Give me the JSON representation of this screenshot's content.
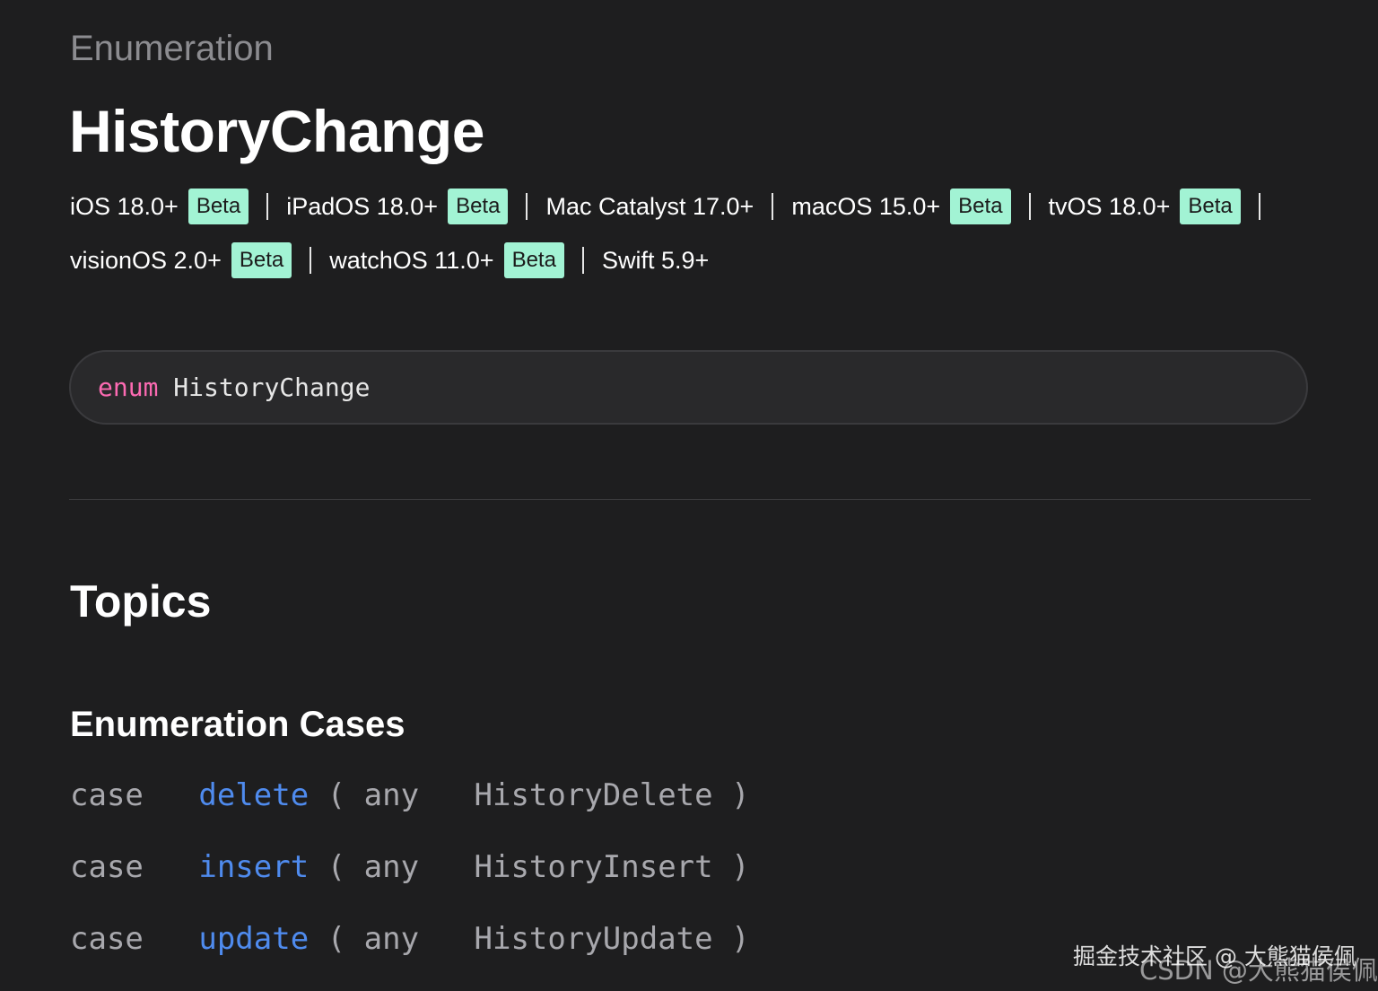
{
  "header": {
    "eyebrow": "Enumeration",
    "title": "HistoryChange"
  },
  "availability": {
    "row1": [
      {
        "label": "iOS 18.0+",
        "badge": "Beta"
      },
      {
        "label": "iPadOS 18.0+",
        "badge": "Beta"
      },
      {
        "label": "Mac Catalyst 17.0+"
      },
      {
        "label": "macOS 15.0+",
        "badge": "Beta"
      },
      {
        "label": "tvOS 18.0+",
        "badge": "Beta"
      }
    ],
    "row2": [
      {
        "label": "visionOS 2.0+",
        "badge": "Beta"
      },
      {
        "label": "watchOS 11.0+",
        "badge": "Beta"
      },
      {
        "label": "Swift 5.9+"
      }
    ]
  },
  "declaration": {
    "keyword": "enum",
    "name": "HistoryChange"
  },
  "topics": {
    "heading": "Topics",
    "section_title": "Enumeration Cases",
    "cases": [
      {
        "keyword": "case",
        "name": "delete",
        "open": "(",
        "param_kw": "any",
        "type": "HistoryDelete",
        "close": ")"
      },
      {
        "keyword": "case",
        "name": "insert",
        "open": "(",
        "param_kw": "any",
        "type": "HistoryInsert",
        "close": ")"
      },
      {
        "keyword": "case",
        "name": "update",
        "open": "(",
        "param_kw": "any",
        "type": "HistoryUpdate",
        "close": ")"
      }
    ]
  },
  "watermarks": {
    "line1": "掘金技术社区 @ 大熊猫侯佩",
    "line2": "CSDN @大熊猫侯佩"
  },
  "colors": {
    "background": "#1e1e1f",
    "beta_badge": "#a2f3d4",
    "keyword_pink": "#fc6ab2",
    "link_blue": "#4f8bee",
    "code_box_bg": "#29292b"
  }
}
